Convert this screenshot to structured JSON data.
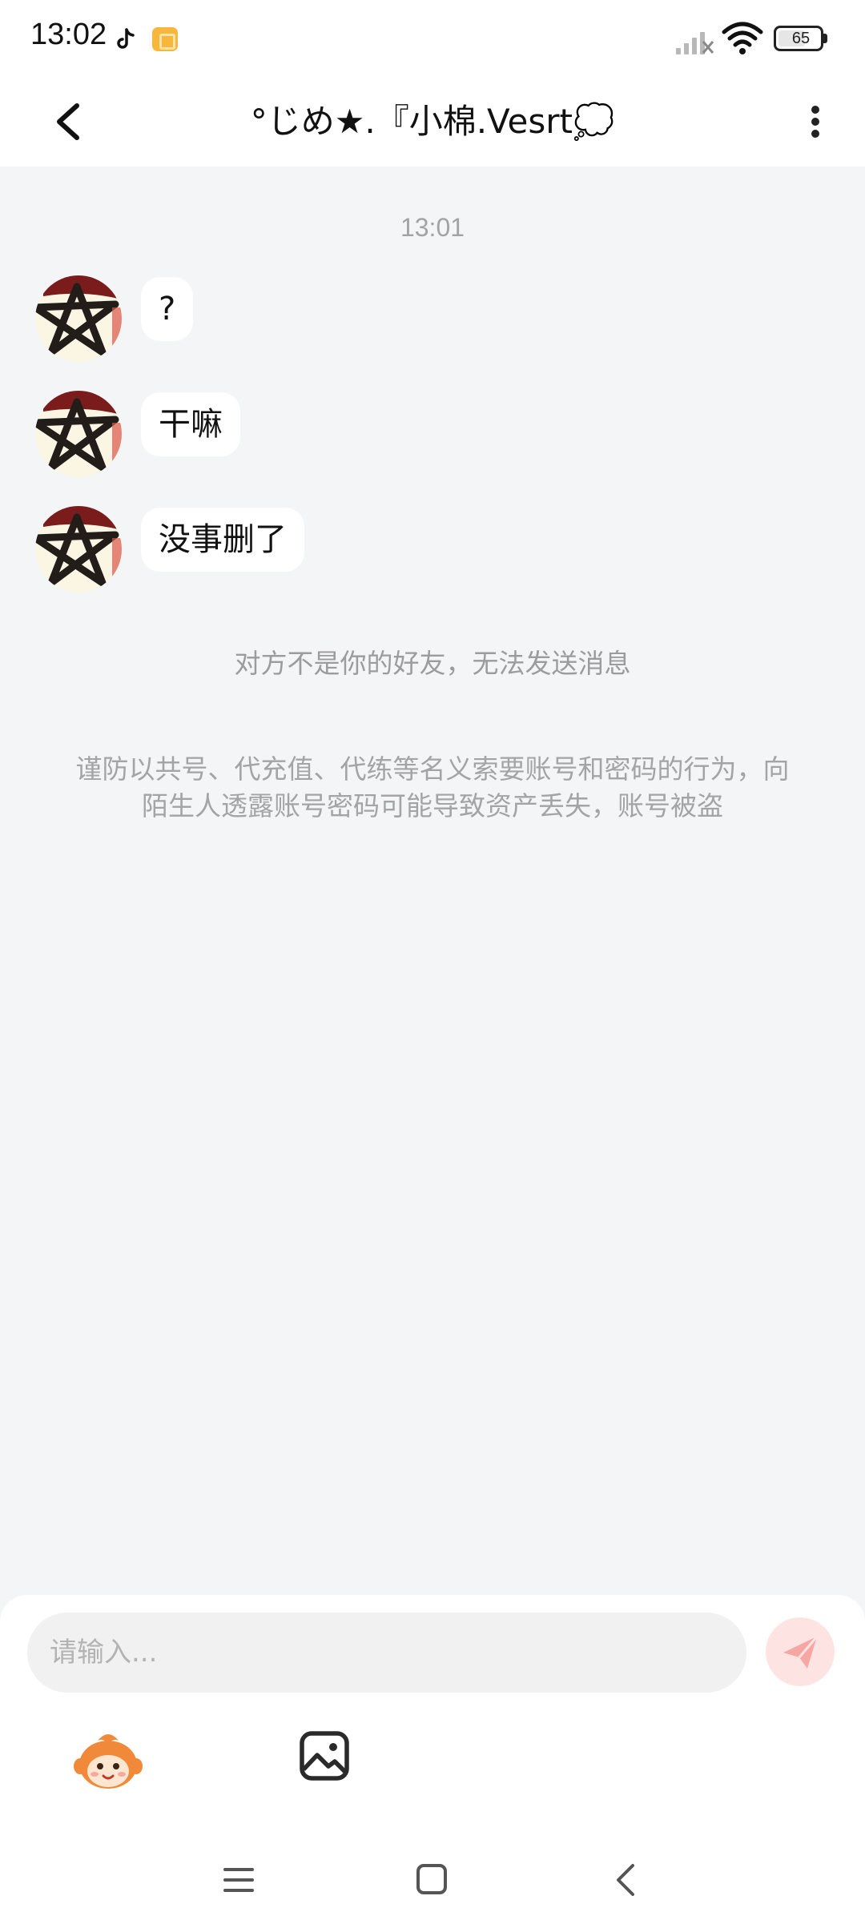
{
  "status_bar": {
    "time": "13:02",
    "battery": "65",
    "battery_fraction": 0.65
  },
  "header": {
    "title": "°じめ★.『小棉.Vesrt💭"
  },
  "chat": {
    "timestamp": "13:01",
    "messages": [
      {
        "text": "?"
      },
      {
        "text": "干嘛"
      },
      {
        "text": "没事删了"
      }
    ],
    "notice": "对方不是你的好友，无法发送消息",
    "warning": "谨防以共号、代充值、代练等名义索要账号和密码的行为，向陌生人透露账号密码可能导致资产丢失，账号被盗"
  },
  "composer": {
    "placeholder": "请输入..."
  },
  "colors": {
    "background": "#f4f5f7",
    "bubble": "#ffffff",
    "send_button_bg": "#fde4e3",
    "send_icon": "#f6a7a3",
    "avatar_dark_red": "#7a1c1c"
  },
  "icons": {
    "back": "chevron-left-icon",
    "more": "more-vertical-icon",
    "send": "paper-plane-icon",
    "mascot": "mascot-icon",
    "image": "image-icon",
    "nav_menu": "menu-icon",
    "nav_home": "home-square-icon",
    "nav_back": "back-icon"
  }
}
